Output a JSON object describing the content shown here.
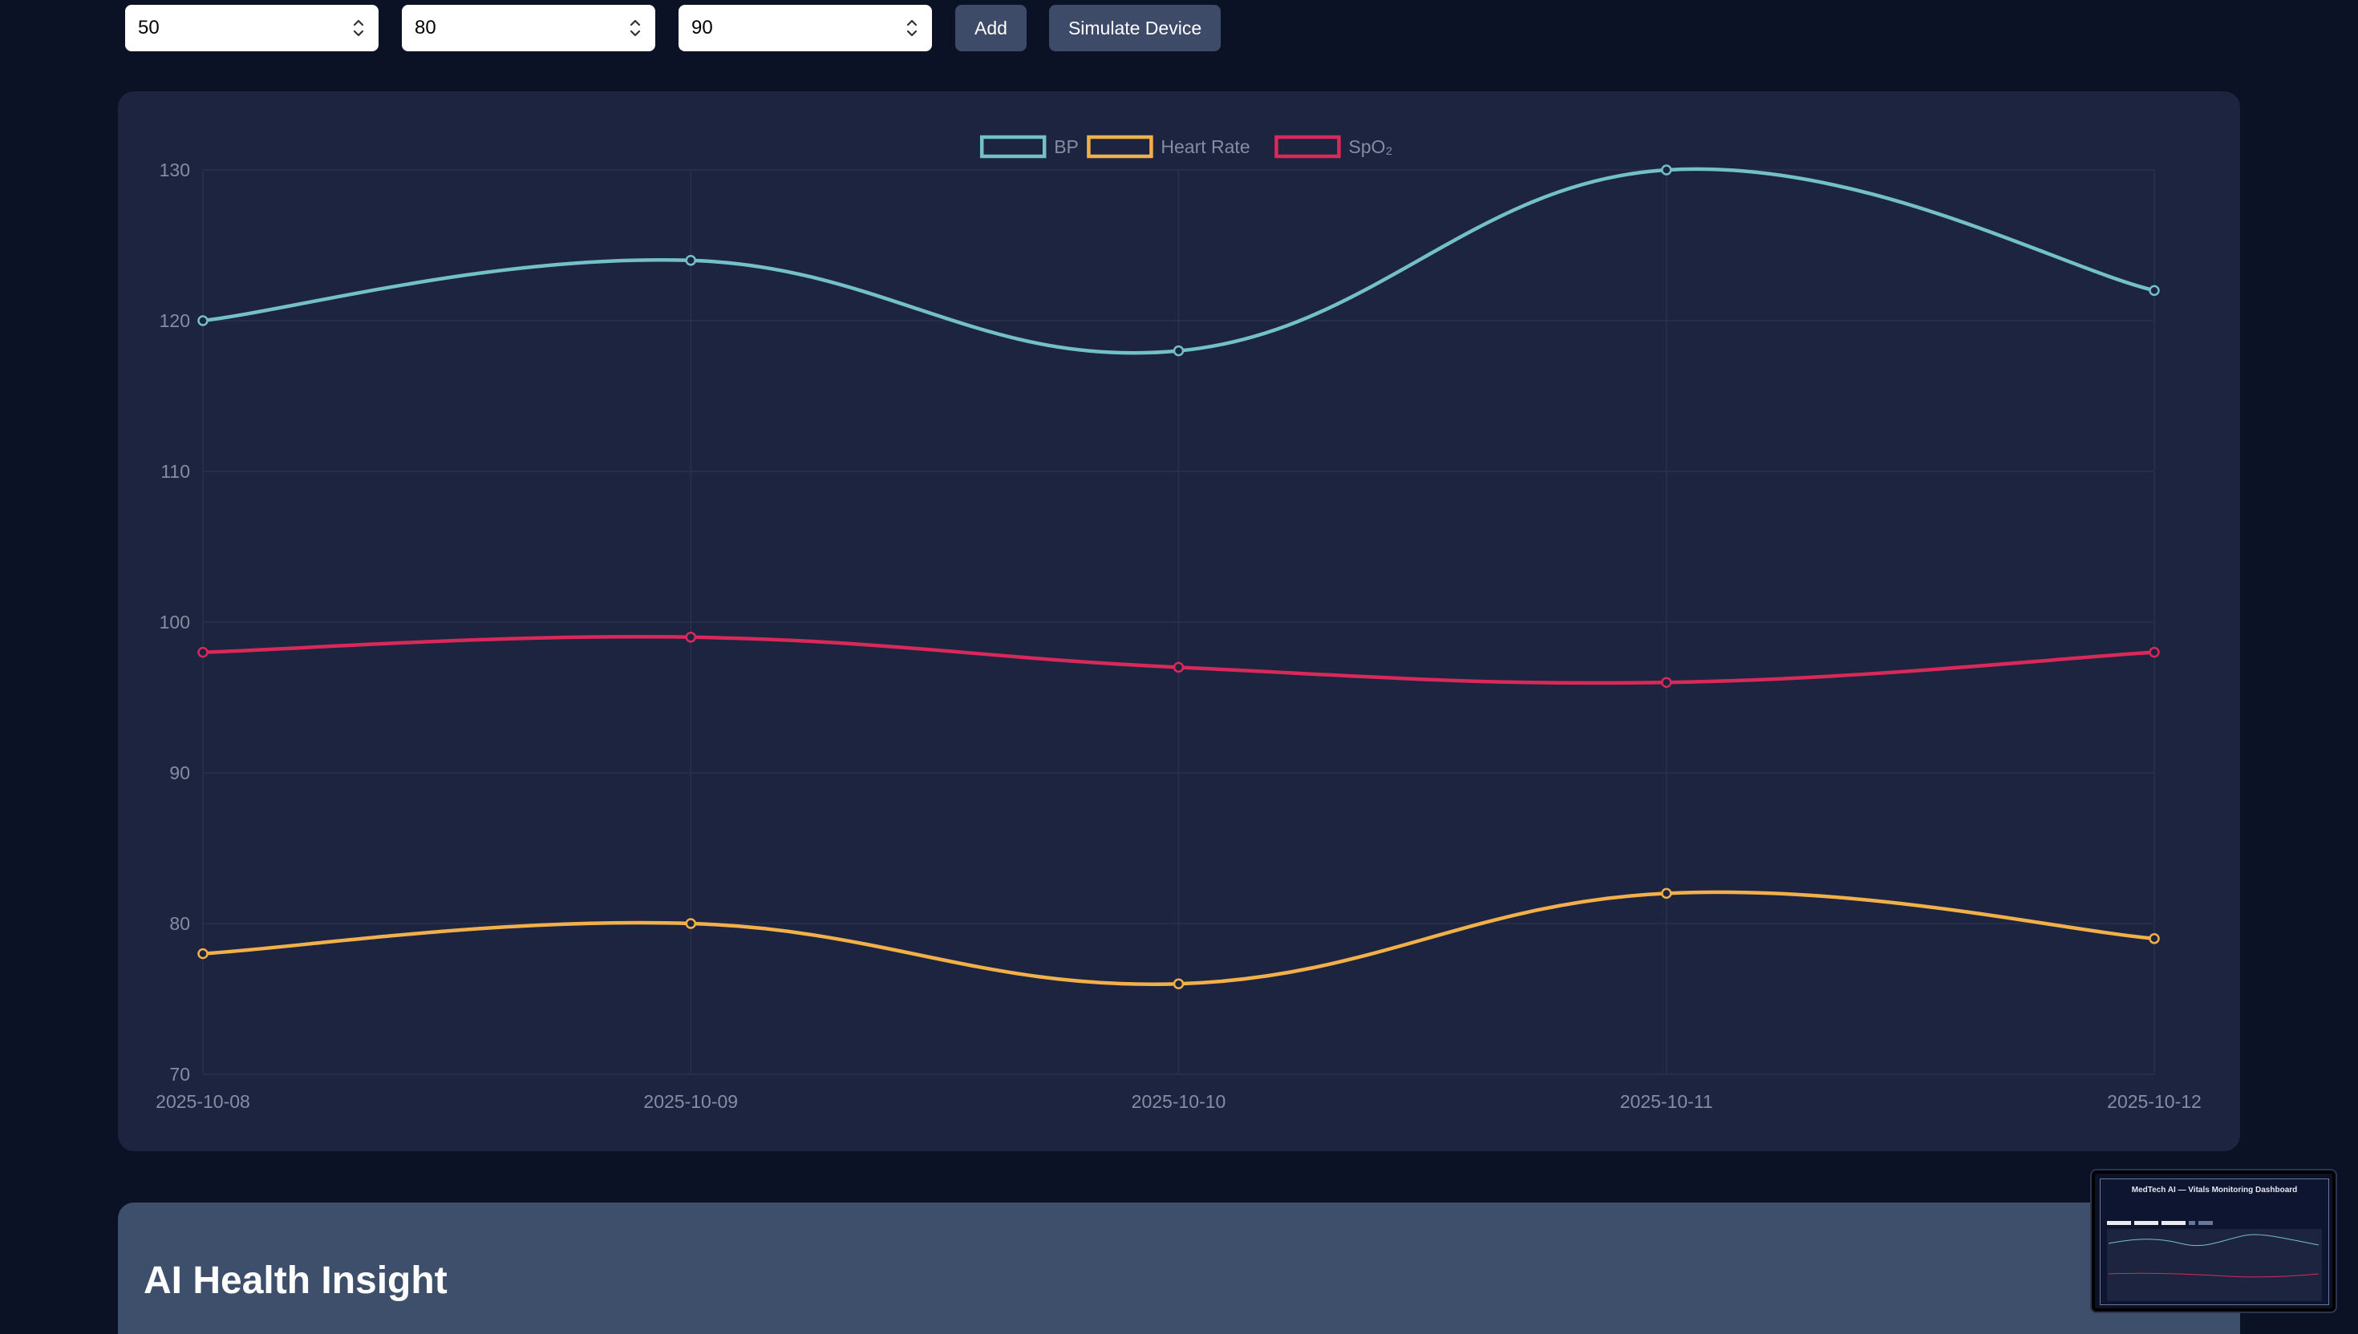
{
  "toolbar": {
    "inputs": [
      {
        "value": "50"
      },
      {
        "value": "80"
      },
      {
        "value": "90"
      }
    ],
    "add_label": "Add",
    "simulate_label": "Simulate Device"
  },
  "chart_data": {
    "type": "line",
    "categories": [
      "2025-10-08",
      "2025-10-09",
      "2025-10-10",
      "2025-10-11",
      "2025-10-12"
    ],
    "series": [
      {
        "name": "BP",
        "values": [
          120,
          124,
          118,
          130,
          122
        ],
        "color": "#74c0c8"
      },
      {
        "name": "Heart Rate",
        "values": [
          78,
          80,
          76,
          82,
          79
        ],
        "color": "#f2b04a"
      },
      {
        "name": "SpO₂",
        "values": [
          98,
          99,
          97,
          96,
          98
        ],
        "color": "#d8295a"
      }
    ],
    "ylim": [
      70,
      130
    ],
    "yticks": [
      70,
      80,
      90,
      100,
      110,
      120,
      130
    ],
    "grid": true,
    "legend": "top-center",
    "smooth": true
  },
  "colors": {
    "background": "#0b1226",
    "card": "#1c243f",
    "insight_card": "#3e4f6b",
    "button": "#3d4a68",
    "tick_text": "#858da2",
    "grid": "#283149"
  },
  "insight": {
    "title": "AI Health Insight"
  },
  "thumbnail": {
    "title": "MedTech AI — Vitals Monitoring Dashboard"
  },
  "icons": {
    "spinner": "spinner-arrows-icon"
  }
}
